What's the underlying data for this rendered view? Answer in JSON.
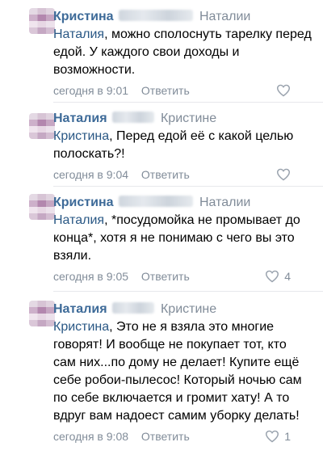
{
  "comments": [
    {
      "author": "Кристина",
      "reply_to": "Наталии",
      "mention": "Наталия",
      "text": ", можно сполоснуть тарелку перед едой. У каждого свои доходы и возможности.",
      "time": "сегодня в 9:01",
      "reply_label": "Ответить",
      "likes": ""
    },
    {
      "author": "Наталия",
      "reply_to": "Кристине",
      "mention": "Кристина",
      "text": ", Перед едой её с какой целью полоскать?!",
      "time": "сегодня в 9:04",
      "reply_label": "Ответить",
      "likes": ""
    },
    {
      "author": "Кристина",
      "reply_to": "Наталии",
      "mention": "Наталия",
      "text": ", *посудомойка не промывает до конца*, хотя я не понимаю с чего вы это взяли.",
      "time": "сегодня в 9:05",
      "reply_label": "Ответить",
      "likes": "4"
    },
    {
      "author": "Наталия",
      "reply_to": "Кристине",
      "mention": "Кристина",
      "text": ", Это не я взяла это многие говорят! И вообще не покупает тот, кто сам них...по дому не делает! Купите ещё себе робои-пылесос! Который ночью сам по себе включается и громит хату! А то вдруг вам надоест самим уборку делать!",
      "time": "сегодня в 9:08",
      "reply_label": "Ответить",
      "likes": "1"
    }
  ],
  "colors": {
    "author": "#3d6a98",
    "mention": "#2a5885",
    "secondary": "#818c99"
  },
  "icons": {
    "like": "heart-outline-icon"
  }
}
